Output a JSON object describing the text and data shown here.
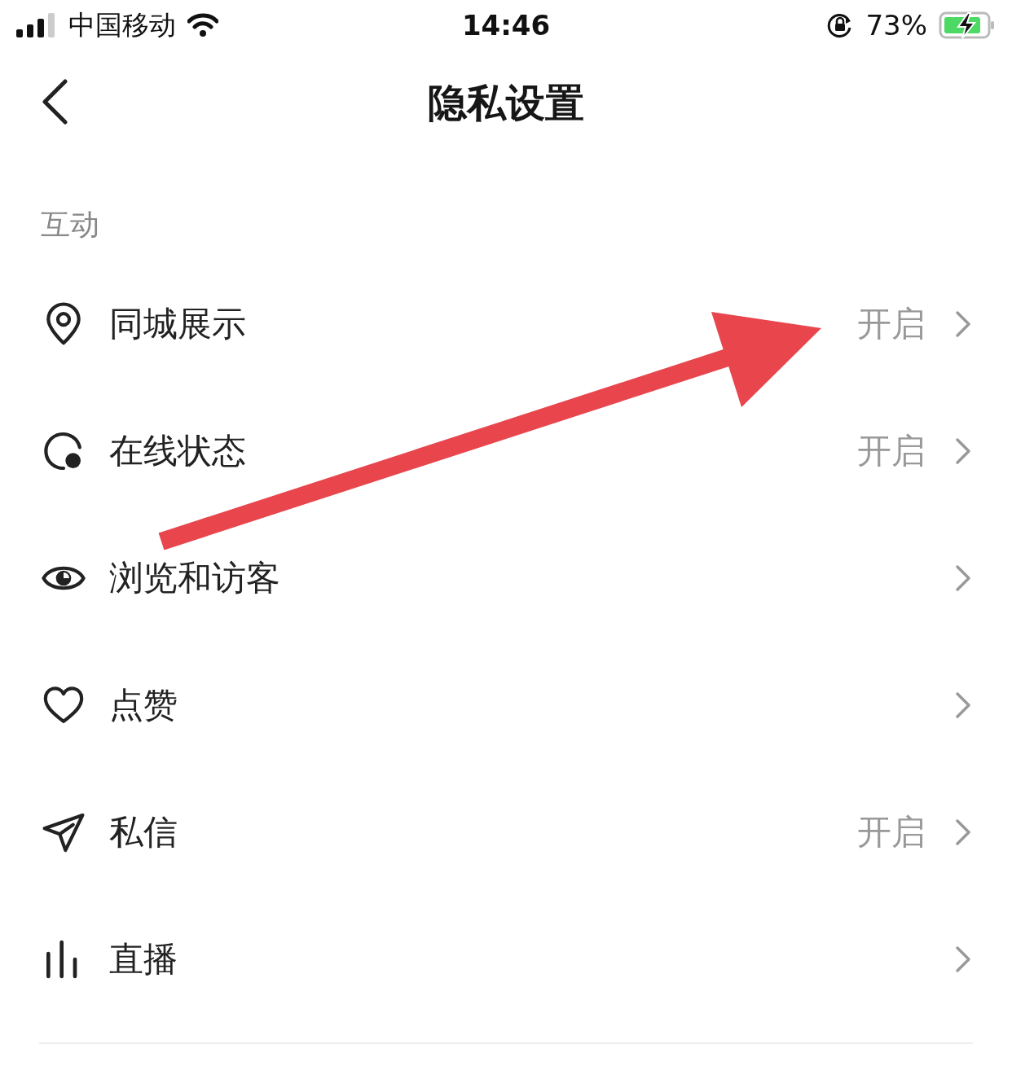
{
  "status_bar": {
    "carrier": "中国移动",
    "time": "14:46",
    "battery": "73%"
  },
  "nav": {
    "title": "隐私设置"
  },
  "section": {
    "title": "互动",
    "items": [
      {
        "kind": "location",
        "label": "同城展示",
        "value": "开启"
      },
      {
        "kind": "online",
        "label": "在线状态",
        "value": "开启"
      },
      {
        "kind": "eye",
        "label": "浏览和访客"
      },
      {
        "kind": "heart",
        "label": "点赞"
      },
      {
        "kind": "send",
        "label": "私信",
        "value": "开启"
      },
      {
        "kind": "bars",
        "label": "直播"
      }
    ]
  }
}
